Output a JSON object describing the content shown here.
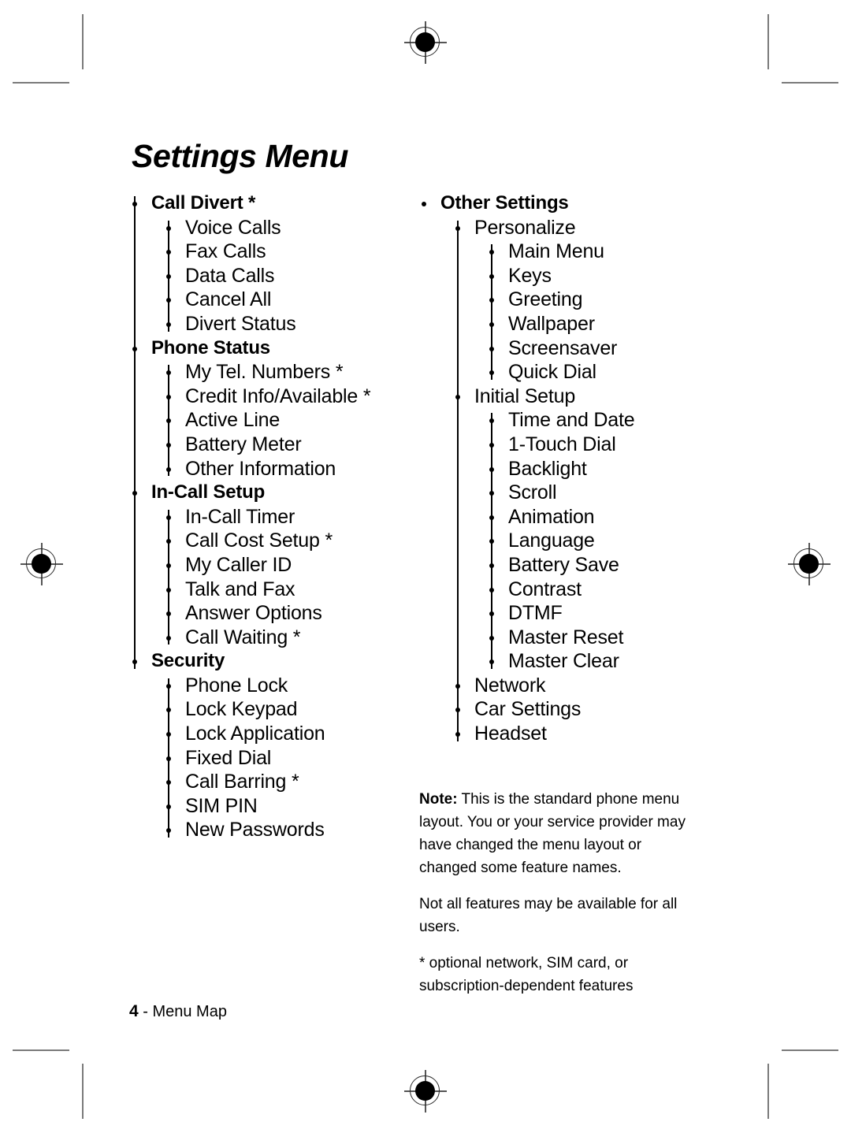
{
  "document": {
    "title": "Settings Menu",
    "footer": {
      "page_number": "4",
      "separator": " - ",
      "section": "Menu Map"
    }
  },
  "columns": {
    "left": [
      {
        "label": "Call Divert *",
        "level": 1,
        "children": [
          {
            "label": "Voice Calls",
            "level": 2
          },
          {
            "label": "Fax Calls",
            "level": 2
          },
          {
            "label": "Data Calls",
            "level": 2
          },
          {
            "label": "Cancel All",
            "level": 2
          },
          {
            "label": "Divert Status",
            "level": 2
          }
        ]
      },
      {
        "label": "Phone Status",
        "level": 1,
        "children": [
          {
            "label": "My Tel. Numbers *",
            "level": 2
          },
          {
            "label": "Credit Info/Available *",
            "level": 2
          },
          {
            "label": "Active Line",
            "level": 2
          },
          {
            "label": "Battery Meter",
            "level": 2
          },
          {
            "label": "Other Information",
            "level": 2
          }
        ]
      },
      {
        "label": "In-Call Setup",
        "level": 1,
        "children": [
          {
            "label": "In-Call Timer",
            "level": 2
          },
          {
            "label": "Call Cost Setup *",
            "level": 2
          },
          {
            "label": "My Caller ID",
            "level": 2
          },
          {
            "label": "Talk and Fax",
            "level": 2
          },
          {
            "label": "Answer Options",
            "level": 2
          },
          {
            "label": "Call Waiting *",
            "level": 2
          }
        ]
      },
      {
        "label": "Security",
        "level": 1,
        "children": [
          {
            "label": "Phone Lock",
            "level": 2
          },
          {
            "label": "Lock Keypad",
            "level": 2
          },
          {
            "label": "Lock Application",
            "level": 2
          },
          {
            "label": "Fixed Dial",
            "level": 2
          },
          {
            "label": "Call Barring *",
            "level": 2
          },
          {
            "label": "SIM PIN",
            "level": 2
          },
          {
            "label": "New Passwords",
            "level": 2
          }
        ]
      }
    ],
    "right": [
      {
        "label": "Other Settings",
        "level": 1,
        "children": [
          {
            "label": "Personalize",
            "level": 2,
            "children": [
              {
                "label": "Main Menu",
                "level": 3
              },
              {
                "label": "Keys",
                "level": 3
              },
              {
                "label": "Greeting",
                "level": 3
              },
              {
                "label": "Wallpaper",
                "level": 3
              },
              {
                "label": "Screensaver",
                "level": 3
              },
              {
                "label": "Quick Dial",
                "level": 3
              }
            ]
          },
          {
            "label": "Initial Setup",
            "level": 2,
            "children": [
              {
                "label": "Time and Date",
                "level": 3
              },
              {
                "label": "1-Touch Dial",
                "level": 3
              },
              {
                "label": "Backlight",
                "level": 3
              },
              {
                "label": "Scroll",
                "level": 3
              },
              {
                "label": "Animation",
                "level": 3
              },
              {
                "label": "Language",
                "level": 3
              },
              {
                "label": "Battery Save",
                "level": 3
              },
              {
                "label": "Contrast",
                "level": 3
              },
              {
                "label": "DTMF",
                "level": 3
              },
              {
                "label": "Master Reset",
                "level": 3
              },
              {
                "label": "Master Clear",
                "level": 3
              }
            ]
          },
          {
            "label": "Network",
            "level": 2
          },
          {
            "label": "Car Settings",
            "level": 2
          },
          {
            "label": "Headset",
            "level": 2
          }
        ]
      }
    ]
  },
  "note": {
    "lead": "Note:",
    "paragraph_1": " This is the standard phone menu layout. You or your service provider may have changed the menu layout or changed some feature names.",
    "paragraph_2": "Not all features may be available for all users.",
    "paragraph_3": "* optional network, SIM card, or subscription-dependent features"
  },
  "print_marks": {
    "registration_icon": "registration-target-icon",
    "crop_icon": "crop-mark-icon",
    "mark_color": "#7a7a7a"
  }
}
